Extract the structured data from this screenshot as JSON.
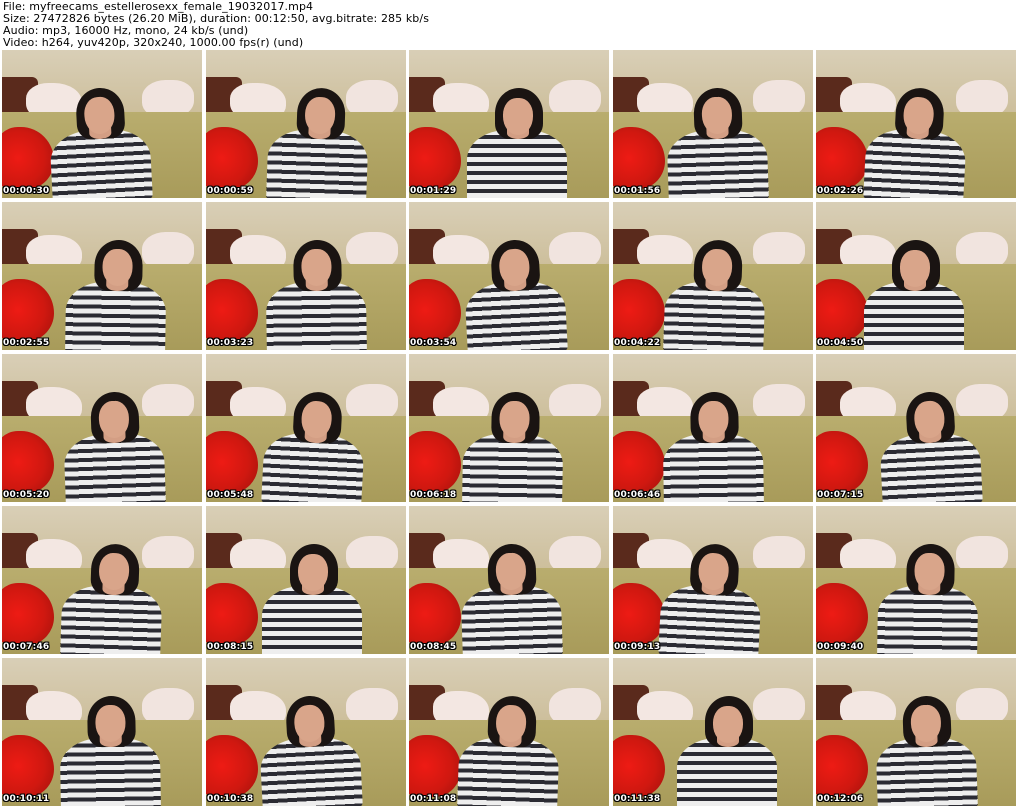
{
  "header": {
    "file": "File: myfreecams_estellerosexx_female_19032017.mp4",
    "size": "Size: 27472826 bytes (26.20 MiB), duration: 00:12:50, avg.bitrate: 285 kb/s",
    "audio": "Audio: mp3, 16000 Hz, mono, 24 kb/s (und)",
    "video": "Video: h264, yuv420p, 320x240, 1000.00 fps(r) (und)"
  },
  "grid": {
    "columns": 5,
    "rows": 5
  },
  "thumbnails": [
    {
      "timestamp": "00:00:30"
    },
    {
      "timestamp": "00:00:59"
    },
    {
      "timestamp": "00:01:29"
    },
    {
      "timestamp": "00:01:56"
    },
    {
      "timestamp": "00:02:26"
    },
    {
      "timestamp": "00:02:55"
    },
    {
      "timestamp": "00:03:23"
    },
    {
      "timestamp": "00:03:54"
    },
    {
      "timestamp": "00:04:22"
    },
    {
      "timestamp": "00:04:50"
    },
    {
      "timestamp": "00:05:20"
    },
    {
      "timestamp": "00:05:48"
    },
    {
      "timestamp": "00:06:18"
    },
    {
      "timestamp": "00:06:46"
    },
    {
      "timestamp": "00:07:15"
    },
    {
      "timestamp": "00:07:46"
    },
    {
      "timestamp": "00:08:15"
    },
    {
      "timestamp": "00:08:45"
    },
    {
      "timestamp": "00:09:13"
    },
    {
      "timestamp": "00:09:40"
    },
    {
      "timestamp": "00:10:11"
    },
    {
      "timestamp": "00:10:38"
    },
    {
      "timestamp": "00:11:08"
    },
    {
      "timestamp": "00:11:38"
    },
    {
      "timestamp": "00:12:06"
    }
  ],
  "colors": {
    "background": "#ffffff",
    "header_text": "#000000",
    "timestamp_text": "#ffffff",
    "timestamp_outline": "#000000"
  }
}
